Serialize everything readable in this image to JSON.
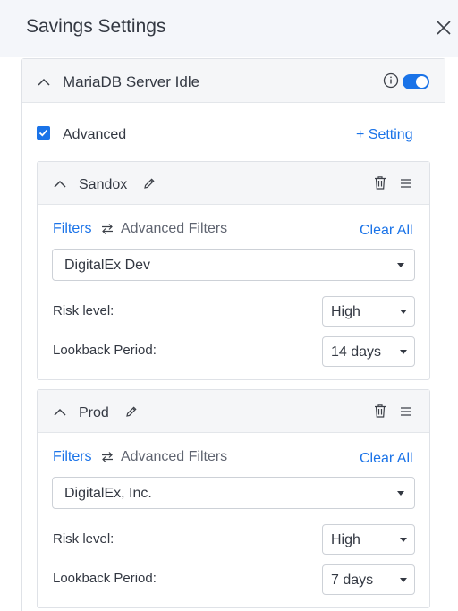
{
  "header": {
    "title": "Savings Settings"
  },
  "panel": {
    "title": "MariaDB Server Idle",
    "enabled": true,
    "advanced_label": "Advanced",
    "advanced_checked": true,
    "add_setting_label": "+ Setting"
  },
  "settings": [
    {
      "name": "Sandox",
      "filters_label": "Filters",
      "advanced_filters_label": "Advanced Filters",
      "clear_all_label": "Clear All",
      "account": "DigitalEx Dev",
      "risk_label": "Risk level:",
      "risk_value": "High",
      "lookback_label": "Lookback Period:",
      "lookback_value": "14 days"
    },
    {
      "name": "Prod",
      "filters_label": "Filters",
      "advanced_filters_label": "Advanced Filters",
      "clear_all_label": "Clear All",
      "account": "DigitalEx, Inc.",
      "risk_label": "Risk level:",
      "risk_value": "High",
      "lookback_label": "Lookback Period:",
      "lookback_value": "7 days"
    }
  ],
  "colors": {
    "accent": "#1a73e8",
    "header_bg": "#f4f6fa",
    "border": "#dfe2e7"
  },
  "icons": [
    "close-icon",
    "chevron-up-icon",
    "info-icon",
    "checkmark-icon",
    "pencil-icon",
    "trash-icon",
    "drag-handle-icon",
    "swap-icon",
    "caret-down-icon"
  ]
}
